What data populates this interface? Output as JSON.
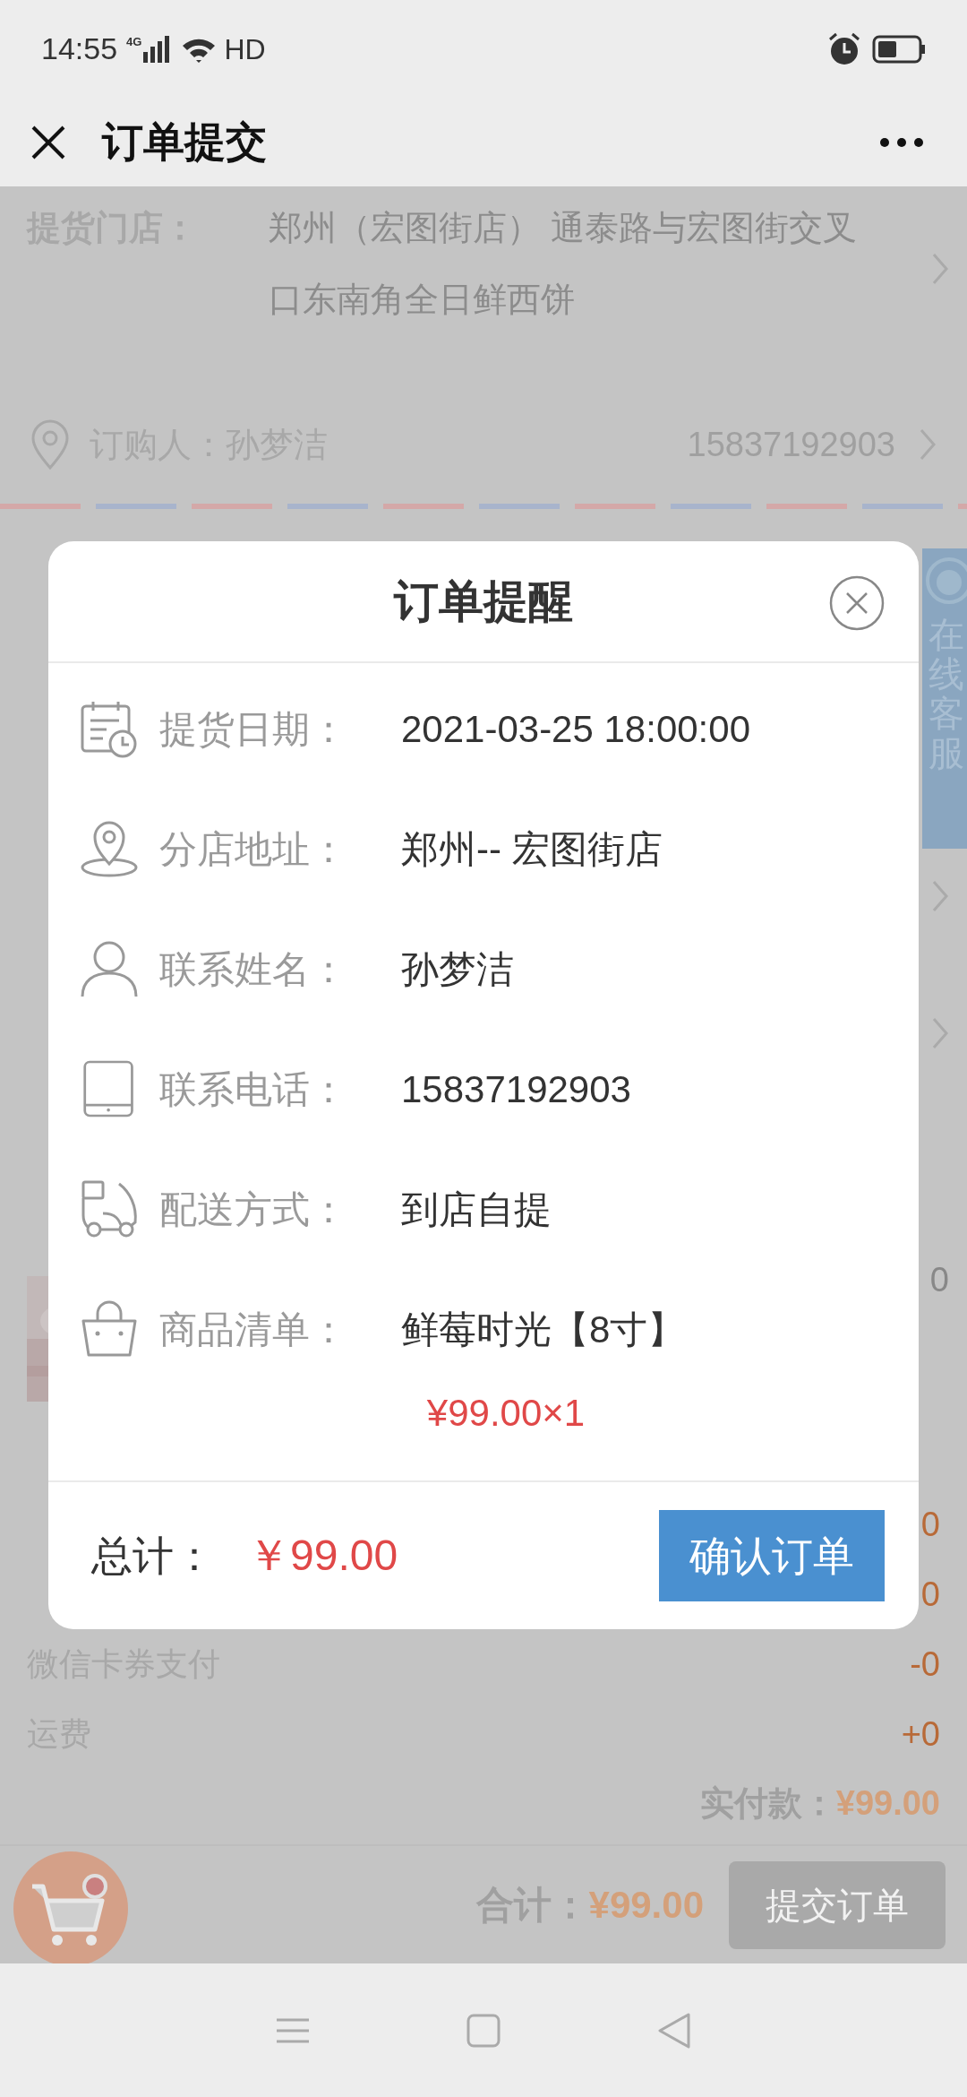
{
  "status_bar": {
    "time": "14:55",
    "network": "4G",
    "hd": "HD"
  },
  "header": {
    "title": "订单提交"
  },
  "store": {
    "label": "提货门店：",
    "address_lines": [
      "郑州（宏图街店） 通泰路与宏图街交叉",
      "口东南角全日鲜西饼"
    ]
  },
  "buyer": {
    "label": "订购人：孙梦洁",
    "phone": "15837192903"
  },
  "product": {
    "kind": "picture",
    "value": "0"
  },
  "summary_rows": [
    {
      "value": "0"
    },
    {
      "value": "0"
    },
    {
      "label": "微信卡券支付",
      "value": "-0"
    },
    {
      "label": "运费",
      "value": "+0"
    }
  ],
  "paid": {
    "label": "实付款：",
    "amount": "¥99.00"
  },
  "bottom_bar": {
    "total_label": "合计：",
    "total": "¥99.00",
    "submit": "提交订单"
  },
  "service_tab": {
    "label": "在线客服"
  },
  "modal": {
    "title": "订单提醒",
    "rows": [
      {
        "kind": "date",
        "label": "提货日期：",
        "value": "2021-03-25 18:00:00"
      },
      {
        "kind": "location",
        "label": "分店地址：",
        "value": "郑州-- 宏图街店"
      },
      {
        "kind": "person",
        "label": "联系姓名：",
        "value": "孙梦洁"
      },
      {
        "kind": "phone",
        "label": "联系电话：",
        "value": "15837192903"
      },
      {
        "kind": "delivery",
        "label": "配送方式：",
        "value": "到店自提"
      },
      {
        "kind": "bag",
        "label": "商品清单：",
        "value": "鲜莓时光【8寸】"
      }
    ],
    "price": "¥99.00×1",
    "total_label": "总计：",
    "total": "￥99.00",
    "confirm": "确认订单"
  }
}
